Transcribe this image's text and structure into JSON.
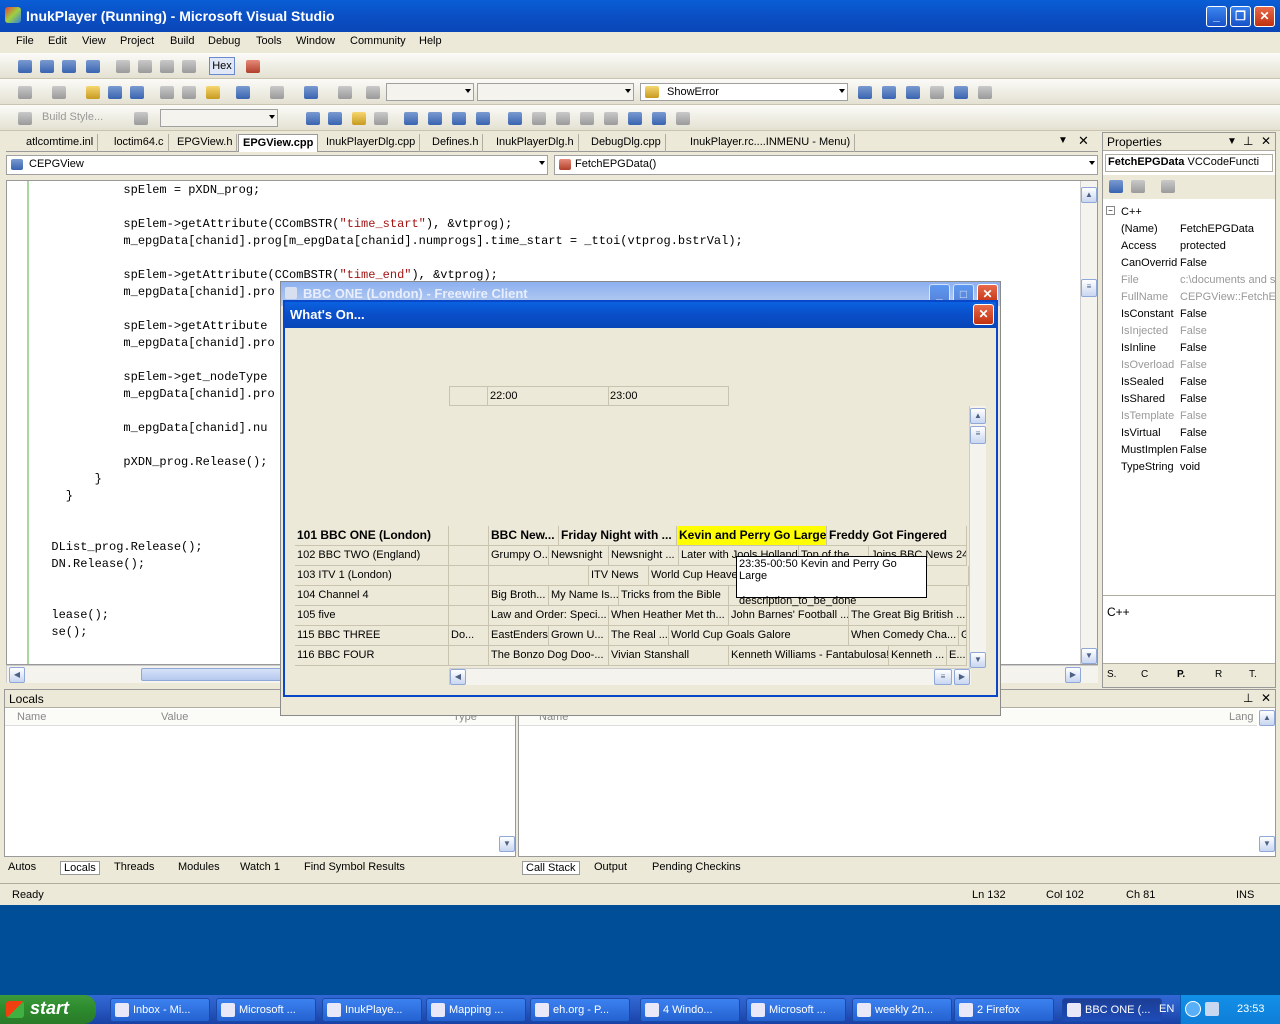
{
  "window": {
    "title": "InukPlayer (Running) - Microsoft Visual Studio"
  },
  "menu": [
    "File",
    "Edit",
    "View",
    "Project",
    "Build",
    "Debug",
    "Tools",
    "Window",
    "Community",
    "Help"
  ],
  "toolbar": {
    "hex_label": "Hex",
    "find_combo": "ShowError",
    "build_style_label": "Build Style..."
  },
  "tabs": [
    {
      "label": "atlcomtime.inl"
    },
    {
      "label": "loctim64.c"
    },
    {
      "label": "EPGView.h"
    },
    {
      "label": "EPGView.cpp"
    },
    {
      "label": "InukPlayerDlg.cpp"
    },
    {
      "label": "Defines.h"
    },
    {
      "label": "InukPlayerDlg.h"
    },
    {
      "label": "DebugDlg.cpp"
    },
    {
      "label": "InukPlayer.rc....INMENU - Menu)"
    }
  ],
  "editor": {
    "class_combo": "CEPGView",
    "method_combo": "FetchEPGData()",
    "lines": [
      {
        "pre": "            spElem = pXDN_prog;",
        "str": "",
        "post": ""
      },
      {
        "pre": "",
        "str": "",
        "post": ""
      },
      {
        "pre": "            spElem->getAttribute(CComBSTR(",
        "str": "\"time_start\"",
        "post": "), &vtprog);"
      },
      {
        "pre": "            m_epgData[chanid].prog[m_epgData[chanid].numprogs].time_start = _ttoi(vtprog.bstrVal);",
        "str": "",
        "post": ""
      },
      {
        "pre": "",
        "str": "",
        "post": ""
      },
      {
        "pre": "            spElem->getAttribute(CComBSTR(",
        "str": "\"time_end\"",
        "post": "), &vtprog);"
      },
      {
        "pre": "            m_epgData[chanid].pro",
        "str": "",
        "post": ""
      },
      {
        "pre": "",
        "str": "",
        "post": ""
      },
      {
        "pre": "            spElem->getAttribute",
        "str": "",
        "post": ""
      },
      {
        "pre": "            m_epgData[chanid].pro",
        "str": "",
        "post": ""
      },
      {
        "pre": "",
        "str": "",
        "post": ""
      },
      {
        "pre": "            spElem->get_nodeType",
        "str": "",
        "post": ""
      },
      {
        "pre": "            m_epgData[chanid].pro",
        "str": "",
        "post": ""
      },
      {
        "pre": "",
        "str": "",
        "post": ""
      },
      {
        "pre": "            m_epgData[chanid].nu",
        "str": "",
        "post": ""
      },
      {
        "pre": "",
        "str": "",
        "post": ""
      },
      {
        "pre": "            pXDN_prog.Release();",
        "str": "",
        "post": ""
      },
      {
        "pre": "        }",
        "str": "",
        "post": ""
      },
      {
        "pre": "    }",
        "str": "",
        "post": ""
      },
      {
        "pre": "",
        "str": "",
        "post": ""
      },
      {
        "pre": "",
        "str": "",
        "post": ""
      },
      {
        "pre": "  DList_prog.Release();",
        "str": "",
        "post": ""
      },
      {
        "pre": "  DN.Release();",
        "str": "",
        "post": ""
      },
      {
        "pre": "",
        "str": "",
        "post": ""
      },
      {
        "pre": "",
        "str": "",
        "post": ""
      },
      {
        "pre": "  lease();",
        "str": "",
        "post": ""
      },
      {
        "pre": "  se();",
        "str": "",
        "post": ""
      }
    ]
  },
  "properties": {
    "title": "Properties",
    "object_name": "FetchEPGData",
    "object_type": "VCCodeFuncti",
    "category": "C++",
    "rows": [
      {
        "k": "(Name)",
        "v": "FetchEPGData",
        "dim": false
      },
      {
        "k": "Access",
        "v": "protected",
        "dim": false
      },
      {
        "k": "CanOverrid",
        "v": "False",
        "dim": false
      },
      {
        "k": "File",
        "v": "c:\\documents and se",
        "dim": true
      },
      {
        "k": "FullName",
        "v": "CEPGView::FetchEP",
        "dim": true
      },
      {
        "k": "IsConstant",
        "v": "False",
        "dim": false
      },
      {
        "k": "IsInjected",
        "v": "False",
        "dim": true
      },
      {
        "k": "IsInline",
        "v": "False",
        "dim": false
      },
      {
        "k": "IsOverload",
        "v": "False",
        "dim": true
      },
      {
        "k": "IsSealed",
        "v": "False",
        "dim": false
      },
      {
        "k": "IsShared",
        "v": "False",
        "dim": false
      },
      {
        "k": "IsTemplate",
        "v": "False",
        "dim": true
      },
      {
        "k": "IsVirtual",
        "v": "False",
        "dim": false
      },
      {
        "k": "MustImplen",
        "v": "False",
        "dim": false
      },
      {
        "k": "TypeString",
        "v": "void",
        "dim": false
      }
    ],
    "desc": "C++",
    "bottom_tabs": [
      "S.",
      "C",
      "P.",
      "R",
      "T."
    ]
  },
  "locals": {
    "title": "Locals",
    "col_name": "Name",
    "col_value": "Value",
    "col_type": "Type",
    "right_col_name": "Name",
    "right_col_lang": "Lang"
  },
  "bottom_tabs_left": [
    "Autos",
    "Locals",
    "Threads",
    "Modules",
    "Watch 1",
    "Find Symbol Results"
  ],
  "bottom_tabs_right": [
    "Call Stack",
    "Output",
    "Pending Checkins"
  ],
  "status": {
    "ready": "Ready",
    "ln": "Ln 132",
    "col": "Col 102",
    "ch": "Ch 81",
    "ins": "INS"
  },
  "outer_dialog": {
    "title": "BBC ONE (London) - Freewire Client"
  },
  "dialog": {
    "title": "What's On...",
    "times": [
      "22:00",
      "23:00"
    ],
    "channels": [
      {
        "name": "101 BBC ONE (London)",
        "bold": true
      },
      {
        "name": "102 BBC TWO (England)",
        "bold": false
      },
      {
        "name": "103 ITV 1 (London)",
        "bold": false
      },
      {
        "name": "104 Channel 4",
        "bold": false
      },
      {
        "name": "105 five",
        "bold": false
      },
      {
        "name": "115 BBC THREE",
        "bold": false
      },
      {
        "name": "116 BBC FOUR",
        "bold": false
      }
    ],
    "programmes": [
      [
        {
          "t": "BBC New...",
          "c": 1,
          "w": 70
        },
        {
          "t": "Friday Night with ...",
          "c": 2,
          "w": 118
        },
        {
          "t": "Kevin and Perry Go Large",
          "c": 3,
          "w": 150,
          "hl": true
        },
        {
          "t": "Freddy Got Fingered",
          "c": 4,
          "w": 140
        }
      ],
      [
        {
          "t": "Grumpy O...",
          "c": 1,
          "w": 60
        },
        {
          "t": "Newsnight",
          "c": 2,
          "w": 60
        },
        {
          "t": "Newsnight ...",
          "c": 3,
          "w": 70
        },
        {
          "t": "Later with Jools Holland",
          "c": 4,
          "w": 120
        },
        {
          "t": "Top of the...",
          "c": 5,
          "w": 70
        },
        {
          "t": "Joins BBC News 24",
          "c": 6,
          "w": 98
        }
      ],
      [
        {
          "t": "",
          "c": 1,
          "w": 100
        },
        {
          "t": "ITV News",
          "c": 2,
          "w": 60
        },
        {
          "t": "World Cup Heaven An...",
          "c": 3,
          "w": 120
        },
        {
          "t": "I",
          "c": 4,
          "w": 238
        }
      ],
      [
        {
          "t": "Big Broth...",
          "c": 1,
          "w": 60
        },
        {
          "t": "My Name Is...",
          "c": 2,
          "w": 70
        },
        {
          "t": "Tricks from the Bible",
          "c": 3,
          "w": 110
        },
        {
          "t": "",
          "c": 4,
          "w": 238
        }
      ],
      [
        {
          "t": "Law and Order: Speci...",
          "c": 1,
          "w": 120
        },
        {
          "t": "When Heather Met th...",
          "c": 2,
          "w": 120
        },
        {
          "t": "John Barnes' Football ...",
          "c": 3,
          "w": 120
        },
        {
          "t": "The Great Big British ...",
          "c": 4,
          "w": 118
        }
      ],
      [
        {
          "t": "Do...",
          "c": 0,
          "w": 40
        },
        {
          "t": "EastEnders",
          "c": 1,
          "w": 60
        },
        {
          "t": "Grown U...",
          "c": 2,
          "w": 60
        },
        {
          "t": "The Real ...",
          "c": 3,
          "w": 60
        },
        {
          "t": "World Cup Goals Galore",
          "c": 4,
          "w": 180
        },
        {
          "t": "When Comedy Cha...",
          "c": 5,
          "w": 110
        },
        {
          "t": "G",
          "c": 6,
          "w": 8
        }
      ],
      [
        {
          "t": "The Bonzo Dog Doo-...",
          "c": 1,
          "w": 120
        },
        {
          "t": "Vivian Stanshall",
          "c": 2,
          "w": 120
        },
        {
          "t": "Kenneth Williams - Fantabulosa!",
          "c": 3,
          "w": 160
        },
        {
          "t": "Kenneth ...",
          "c": 4,
          "w": 58
        },
        {
          "t": "E...",
          "c": 5,
          "w": 20
        }
      ]
    ],
    "tooltip": {
      "line1": "23:35-00:50 Kevin and Perry Go Large",
      "line2": "description_to_be_done"
    }
  },
  "taskbar": {
    "start": "start",
    "items": [
      "Inbox - Mi...",
      "Microsoft ...",
      "InukPlaye...",
      "Mapping ...",
      "eh.org - P...",
      "4 Windo...",
      "Microsoft ...",
      "weekly 2n...",
      "2 Firefox",
      "BBC ONE (..."
    ],
    "lang": "EN",
    "clock": "23:53"
  }
}
